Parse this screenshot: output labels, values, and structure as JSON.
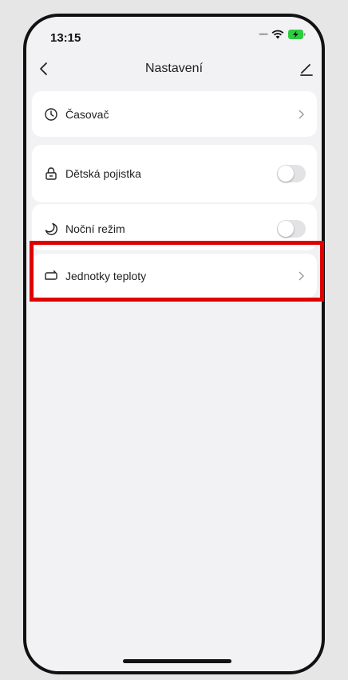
{
  "status_bar": {
    "time": "13:15"
  },
  "header": {
    "title": "Nastavení"
  },
  "settings": [
    {
      "label": "Časovač",
      "icon": "clock-icon",
      "control": "chevron"
    },
    {
      "label": "Dětská pojistka",
      "icon": "lock-icon",
      "control": "toggle",
      "on": false
    },
    {
      "label": "Noční režim",
      "icon": "moon-icon",
      "control": "toggle",
      "on": false
    },
    {
      "label": "Jednotky teploty",
      "icon": "swap-icon",
      "control": "chevron"
    }
  ],
  "colors": {
    "highlight": "#e00000",
    "background": "#f2f2f4",
    "card": "#ffffff"
  }
}
